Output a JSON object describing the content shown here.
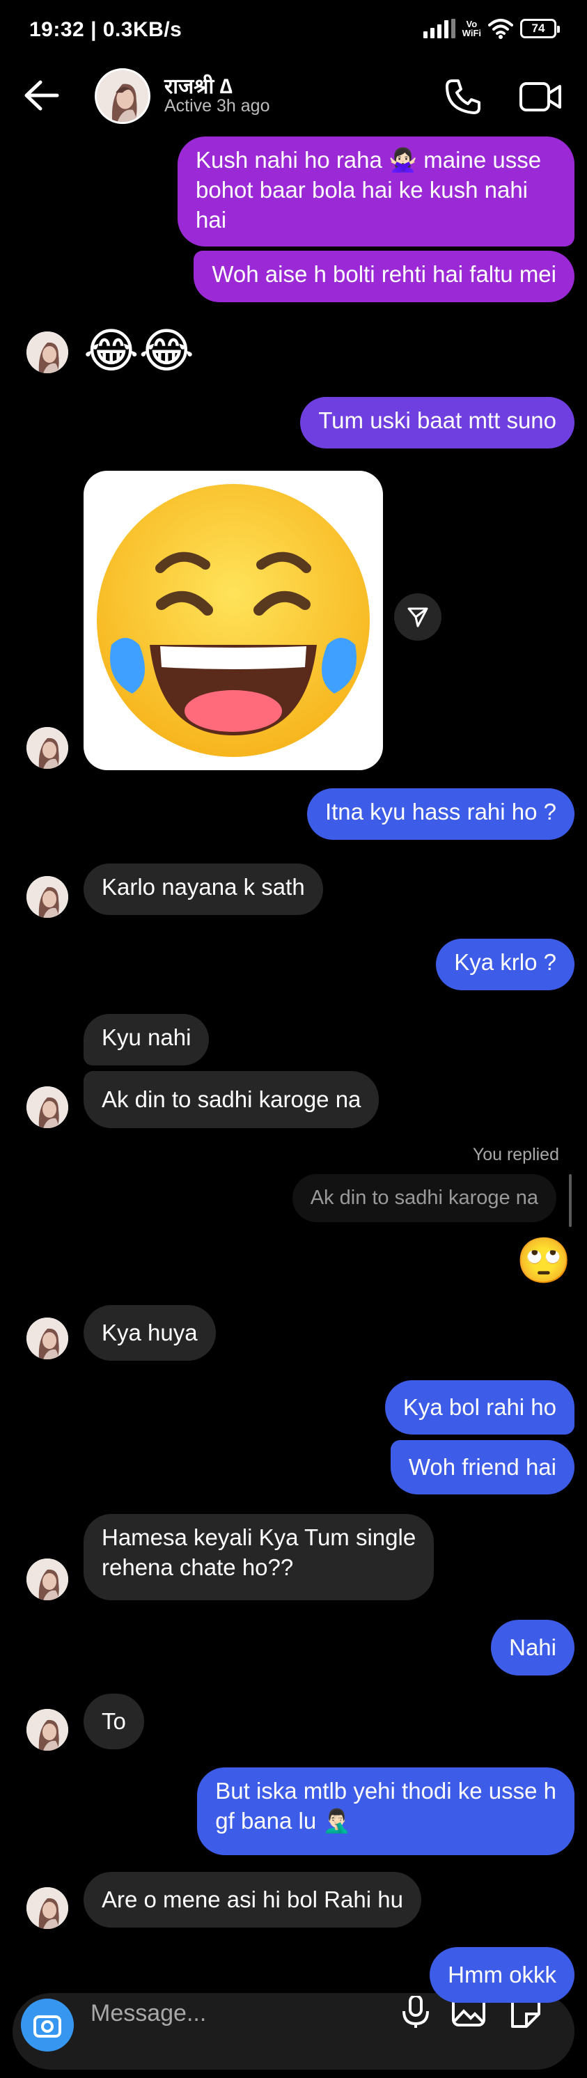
{
  "status_bar": {
    "time": "19:32 | 0.3KB/s",
    "volte_top": "Vo",
    "volte_bottom": "WiFi",
    "battery": "74"
  },
  "header": {
    "name": "राजश्री ∆",
    "status": "Active 3h ago"
  },
  "messages": {
    "m1": "Kush nahi ho raha 🙅🏻‍♀️ maine usse",
    "m1b": "bohot baar bola hai ke kush nahi",
    "m1c": "hai",
    "m2": "Woh aise h bolti rehti hai faltu mei",
    "m3": "😂😂",
    "m4": "Tum uski baat mtt suno",
    "m5": "Itna kyu hass rahi ho ?",
    "m6": "Karlo nayana k sath",
    "m7": "Kya krlo ?",
    "m8": "Kyu nahi",
    "m9": "Ak din to sadhi karoge na",
    "you_replied": "You replied",
    "reply_quote": "Ak din to sadhi karoge na",
    "m10": "🙄",
    "m11": "Kya huya",
    "m12": "Kya bol rahi ho",
    "m13": "Woh friend hai",
    "m14a": "Hamesa keyali Kya Tum single",
    "m14b": "rehena chate ho??",
    "m15": "Nahi",
    "m16": "To",
    "m17a": "But iska mtlb yehi thodi ke usse h",
    "m17b": "gf bana lu 🤦🏻‍♂️",
    "m18": "Are o mene asi hi bol Rahi hu",
    "m19": "Hmm okkk"
  },
  "composer": {
    "placeholder": "Message..."
  },
  "colors": {
    "purple": "#9b2ad6",
    "violet": "#6f3fe0",
    "blue": "#3d5ce8",
    "incoming": "#262626",
    "camera": "#3797f0"
  }
}
